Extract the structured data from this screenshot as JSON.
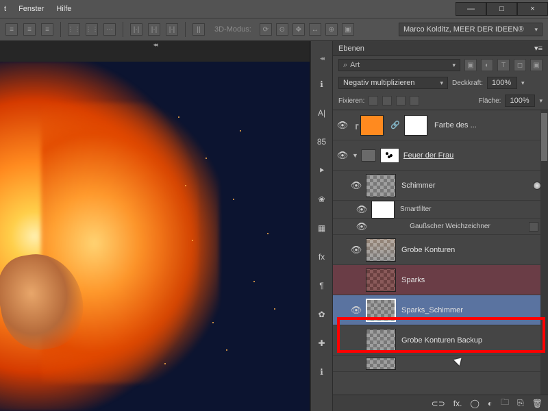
{
  "menu": {
    "items": [
      "t",
      "Fenster",
      "Hilfe"
    ]
  },
  "window_buttons": {
    "minimize": "—",
    "maximize": "□",
    "close": "×"
  },
  "toolbar": {
    "mode_label": "3D-Modus:",
    "user_dropdown": "Marco Kolditz, MEER DER IDEEN®"
  },
  "sidebar_icons": [
    "ℹ︎",
    "A|",
    "85",
    "⯈",
    "❀",
    "▦",
    "fx",
    "¶",
    "✿",
    "✚",
    "ℹ︎"
  ],
  "layers_panel": {
    "title": "Ebenen",
    "search_placeholder": "Art",
    "blend_mode": "Negativ multiplizieren",
    "opacity_label": "Deckkraft:",
    "opacity_value": "100%",
    "lock_label": "Fixieren:",
    "fill_label": "Fläche:",
    "fill_value": "100%",
    "layers": [
      {
        "name": "Farbe des ..."
      },
      {
        "name": "Feuer der Frau"
      },
      {
        "name": "Schimmer"
      },
      {
        "name": "Smartfilter"
      },
      {
        "name": "Gaußscher Weichzeichner"
      },
      {
        "name": "Grobe Konturen"
      },
      {
        "name": "Sparks"
      },
      {
        "name": "Sparks_Schimmer"
      },
      {
        "name": "Grobe Konturen Backup"
      }
    ]
  }
}
